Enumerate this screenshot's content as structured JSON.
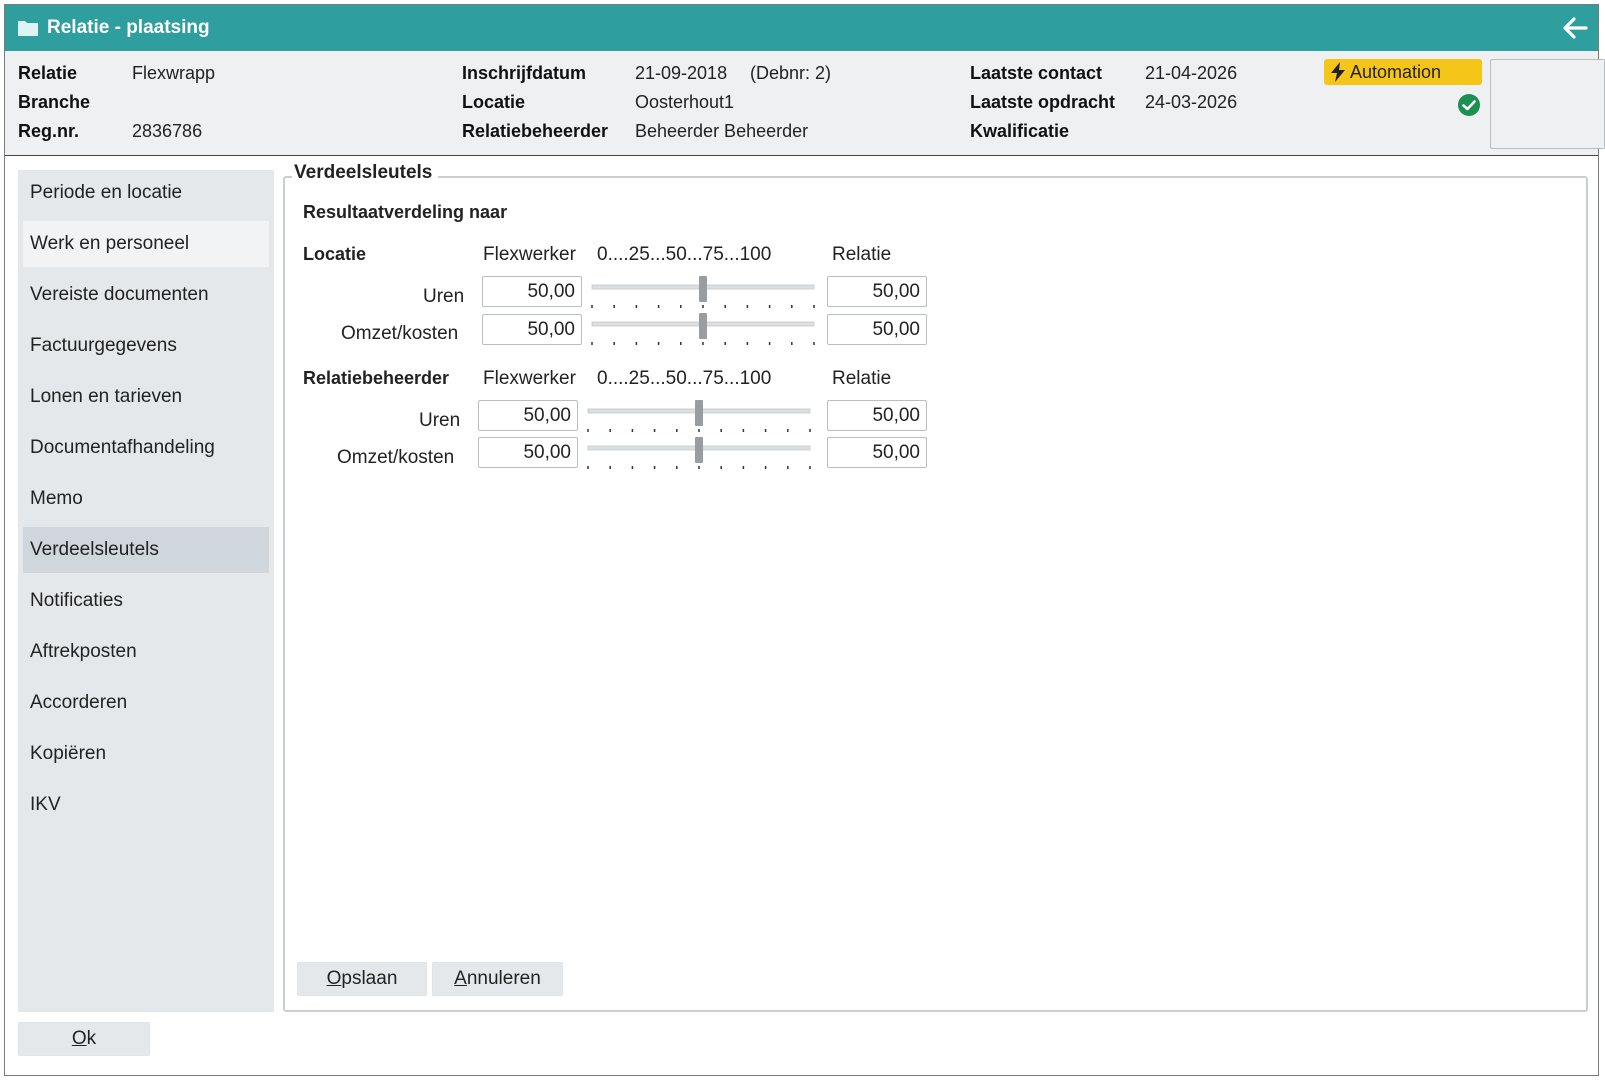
{
  "window": {
    "title": "Relatie - plaatsing"
  },
  "header": {
    "relatie_label": "Relatie",
    "relatie_value": "Flexwrapp",
    "branche_label": "Branche",
    "branche_value": "",
    "regnr_label": "Reg.nr.",
    "regnr_value": "2836786",
    "inschrijf_label": "Inschrijfdatum",
    "inschrijf_value": "21-09-2018",
    "debnr": "(Debnr: 2)",
    "locatie_label": "Locatie",
    "locatie_value": "Oosterhout1",
    "beheerder_label": "Relatiebeheerder",
    "beheerder_value": "Beheerder Beheerder",
    "laatste_contact_label": "Laatste contact",
    "laatste_contact_value": "21-04-2026",
    "laatste_opdracht_label": "Laatste opdracht",
    "laatste_opdracht_value": "24-03-2026",
    "kwalificatie_label": "Kwalificatie",
    "kwalificatie_value": "",
    "automation_label": "Automation",
    "colors": {
      "titlebar": "#2e9e9e",
      "automation": "#f5c518",
      "ok_check": "#1a9150"
    }
  },
  "sidebar": {
    "items": [
      {
        "label": "Periode en locatie"
      },
      {
        "label": "Werk en personeel"
      },
      {
        "label": "Vereiste documenten"
      },
      {
        "label": "Factuurgegevens"
      },
      {
        "label": "Lonen en tarieven"
      },
      {
        "label": "Documentafhandeling"
      },
      {
        "label": "Memo"
      },
      {
        "label": "Verdeelsleutels"
      },
      {
        "label": "Notificaties"
      },
      {
        "label": "Aftrekposten"
      },
      {
        "label": "Accorderen"
      },
      {
        "label": "Kopiëren"
      },
      {
        "label": "IKV"
      }
    ],
    "active_index": 7
  },
  "panel": {
    "legend": "Verdeelsleutels",
    "subheading": "Resultaatverdeling naar",
    "sections": [
      {
        "title": "Locatie",
        "col_left": "Flexwerker",
        "scale": "0....25...50...75...100",
        "col_right": "Relatie",
        "rows": [
          {
            "label": "Uren",
            "left": "50,00",
            "right": "50,00",
            "level": 50
          },
          {
            "label": "Omzet/kosten",
            "left": "50,00",
            "right": "50,00",
            "level": 50
          }
        ]
      },
      {
        "title": "Relatiebeheerder",
        "col_left": "Flexwerker",
        "scale": "0....25...50...75...100",
        "col_right": "Relatie",
        "rows": [
          {
            "label": "Uren",
            "left": "50,00",
            "right": "50,00",
            "level": 50
          },
          {
            "label": "Omzet/kosten",
            "left": "50,00",
            "right": "50,00",
            "level": 50
          }
        ]
      }
    ],
    "buttons": {
      "save_first": "O",
      "save_rest": "pslaan",
      "cancel_first": "A",
      "cancel_rest": "nnuleren"
    }
  },
  "footer": {
    "ok_first": "O",
    "ok_rest": "k"
  }
}
